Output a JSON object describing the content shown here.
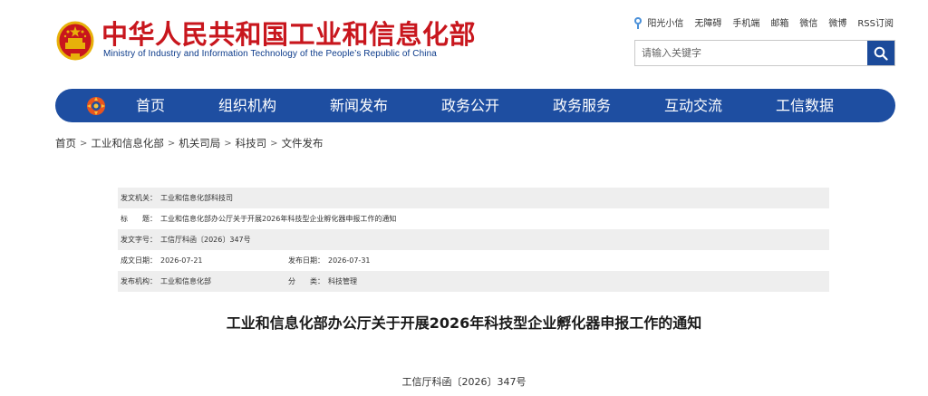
{
  "header": {
    "title": "中华人民共和国工业和信息化部",
    "subtitle": "Ministry of Industry and Information Technology of the People’s Republic of China"
  },
  "top_links": [
    "阳光小信",
    "无障碍",
    "手机端",
    "邮箱",
    "微信",
    "微博",
    "RSS订阅"
  ],
  "search": {
    "placeholder": "请输入关键字",
    "icon": "search-icon"
  },
  "nav": [
    "首页",
    "组织机构",
    "新闻发布",
    "政务公开",
    "政务服务",
    "互动交流",
    "工信数据"
  ],
  "breadcrumb": [
    "首页",
    "工业和信息化部",
    "机关司局",
    "科技司",
    "文件发布"
  ],
  "meta": {
    "issuer_label": "发文机关：",
    "issuer": "工业和信息化部科技司",
    "title_label": "标　　题：",
    "title": "工业和信息化部办公厅关于开展2026年科技型企业孵化器申报工作的通知",
    "docno_label": "发文字号：",
    "docno": "工信厅科函〔2026〕347号",
    "created_label": "成文日期：",
    "created": "2026-07-21",
    "published_label": "发布日期：",
    "published": "2026-07-31",
    "org_label": "发布机构：",
    "org": "工业和信息化部",
    "category_label": "分　　类：",
    "category": "科技管理"
  },
  "article": {
    "title": "工业和信息化部办公厅关于开展2026年科技型企业孵化器申报工作的通知",
    "number": "工信厅科函〔2026〕347号"
  },
  "colors": {
    "brand_red": "#c8161d",
    "nav_blue": "#1e4ea1",
    "search_blue": "#1b4a9a"
  }
}
